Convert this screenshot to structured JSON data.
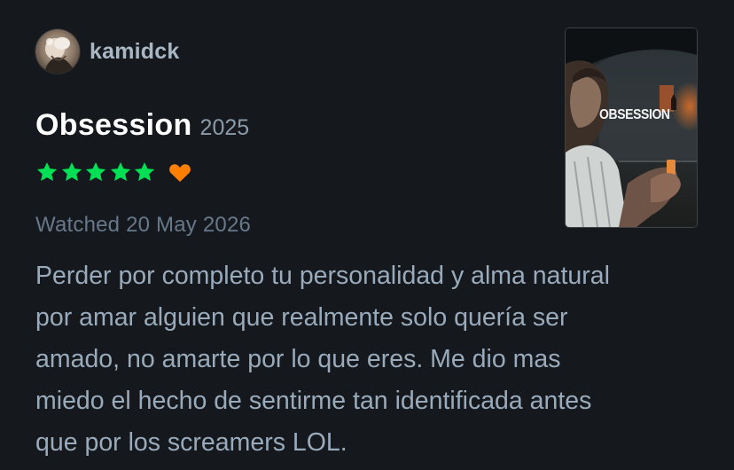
{
  "user": {
    "username": "kamidck",
    "avatar_icon": "user-avatar"
  },
  "film": {
    "title": "Obsession",
    "year": "2025",
    "poster_text": "OBSESSION"
  },
  "rating": {
    "stars": 5,
    "max_stars": 5,
    "liked": true,
    "star_color": "#00e054",
    "heart_color": "#ff8000"
  },
  "watched": {
    "text": "Watched 20 May 2026"
  },
  "review": {
    "line1": "Perder por completo tu personalidad y alma natural",
    "line2": "por amar alguien que realmente solo quería ser",
    "line3": "amado, no amarte por lo que eres. Me dio mas",
    "line4": "miedo el hecho de sentirme tan identificada antes",
    "line5": "que por los screamers LOL."
  },
  "colors": {
    "background": "#15191e",
    "title": "#ffffff",
    "body_text": "#99aabb",
    "muted": "#66788a"
  }
}
